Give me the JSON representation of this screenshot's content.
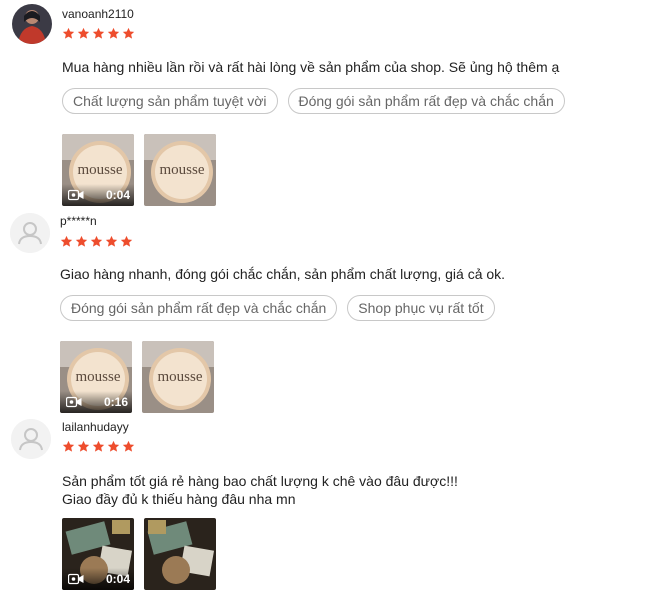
{
  "reviews": [
    {
      "username": "vanoanh2110",
      "rating": 5,
      "avatar": "user-photo",
      "comment": "Mua hàng nhiều lần rồi và rất hài lòng về sản phẩm của shop. Sẽ ủng hộ thêm ạ",
      "tags": [
        "Chất lượng sản phẩm tuyệt vời",
        "Đóng gói sản phẩm rất đẹp và chắc chắn"
      ],
      "media": [
        {
          "kind": "video",
          "duration": "0:04",
          "label": "mousse"
        },
        {
          "kind": "image",
          "label": "mousse"
        }
      ]
    },
    {
      "username": "p*****n",
      "rating": 5,
      "avatar": "default-user-icon",
      "comment": "Giao hàng nhanh, đóng gói chắc chắn, sản phẩm chất lượng, giá cả ok.",
      "tags": [
        "Đóng gói sản phẩm rất đẹp và chắc chắn",
        "Shop phục vụ rất tốt"
      ],
      "media": [
        {
          "kind": "video",
          "duration": "0:16",
          "label": "mousse"
        },
        {
          "kind": "image",
          "label": "mousse"
        }
      ]
    },
    {
      "username": "lailanhudayy",
      "rating": 5,
      "avatar": "default-user-icon",
      "comment": "Sản phẩm tốt giá rẻ hàng bao chất lượng k chê vào đâu được!!!\nGiao đầy đủ k thiếu hàng đâu nha mn",
      "tags": [],
      "media": [
        {
          "kind": "video",
          "duration": "0:04",
          "label": ""
        },
        {
          "kind": "image",
          "label": ""
        }
      ]
    }
  ],
  "colors": {
    "star": "#ee4d2d",
    "tag_border": "#c8c8c8",
    "tag_text": "#666666"
  },
  "icons": {
    "star": "star-icon",
    "video": "video-camera-icon",
    "default_avatar": "user-silhouette-icon"
  }
}
